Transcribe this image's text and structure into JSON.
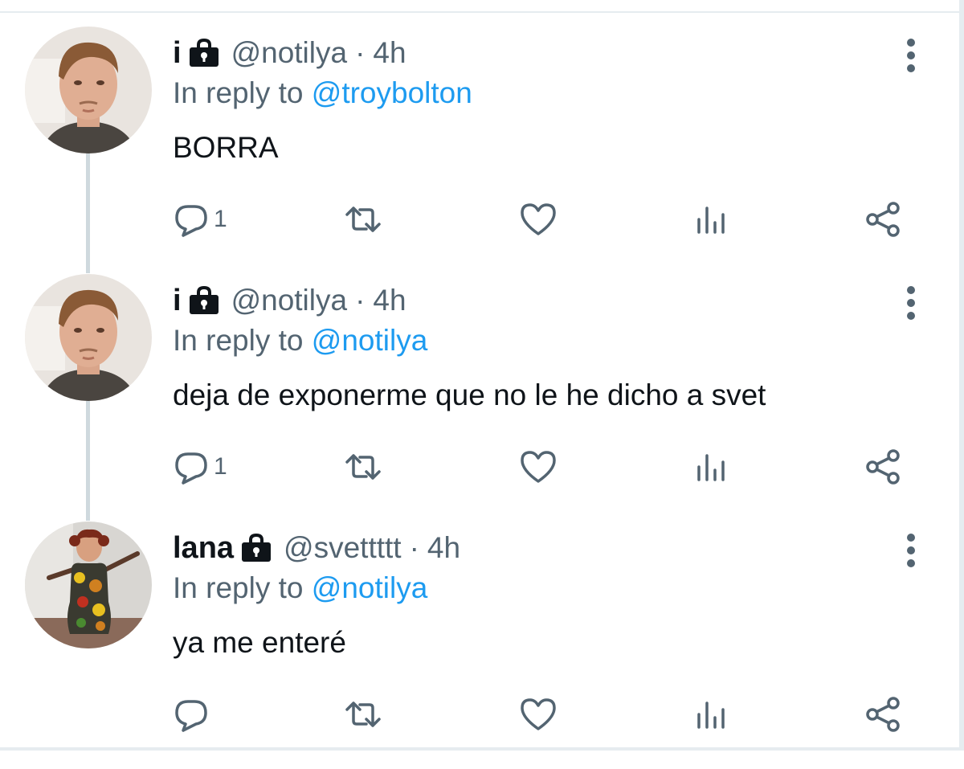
{
  "tweets": [
    {
      "display_name": "i",
      "handle": "@notilya",
      "separator": "·",
      "time": "4h",
      "reply_prefix": "In reply to",
      "reply_to": "@troybolton",
      "text": "BORRA",
      "reply_count": "1",
      "avatar": "man-avatar"
    },
    {
      "display_name": "i",
      "handle": "@notilya",
      "separator": "·",
      "time": "4h",
      "reply_prefix": "In reply to",
      "reply_to": "@notilya",
      "text": "deja de exponerme que no le he dicho a svet",
      "reply_count": "1",
      "avatar": "man-avatar"
    },
    {
      "display_name": "lana",
      "handle": "@svettttt",
      "separator": "·",
      "time": "4h",
      "reply_prefix": "In reply to",
      "reply_to": "@notilya",
      "text": "ya me enteré",
      "reply_count": "",
      "avatar": "woman-avatar"
    }
  ],
  "icons": {
    "protected": "lock-icon",
    "more": "more-vertical-icon",
    "reply": "reply-icon",
    "retweet": "retweet-icon",
    "like": "heart-icon",
    "analytics": "analytics-icon",
    "share": "share-icon"
  },
  "colors": {
    "text": "#0f1419",
    "secondary": "#536471",
    "link": "#1d9bf0",
    "thread_line": "#cfd9de"
  }
}
